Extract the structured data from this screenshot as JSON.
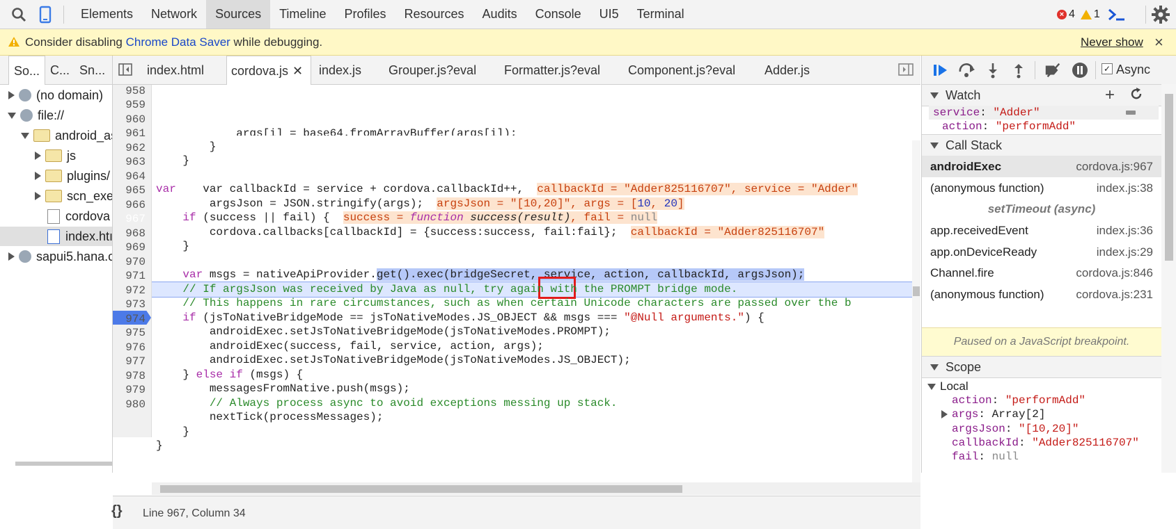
{
  "top_tabs": [
    "Elements",
    "Network",
    "Sources",
    "Timeline",
    "Profiles",
    "Resources",
    "Audits",
    "Console",
    "UI5",
    "Terminal"
  ],
  "active_top_tab": "Sources",
  "counts": {
    "errors": "4",
    "warnings": "1"
  },
  "infobar": {
    "prefix": "Consider disabling ",
    "link": "Chrome Data Saver",
    "suffix": " while debugging.",
    "dismiss": "Never show"
  },
  "nav_tabs": [
    "So...",
    "C...",
    "Sn..."
  ],
  "tree": [
    {
      "label": "(no domain)"
    },
    {
      "label": "file://"
    },
    {
      "label": "android_as"
    },
    {
      "label": "js"
    },
    {
      "label": "plugins/"
    },
    {
      "label": "scn_exer"
    },
    {
      "label": "cordova"
    },
    {
      "label": "index.htı"
    },
    {
      "label": "sapui5.hana.c"
    }
  ],
  "file_tabs": [
    "index.html",
    "cordova.js",
    "index.js",
    "Grouper.js?eval",
    "Formatter.js?eval",
    "Component.js?eval",
    "Adder.js"
  ],
  "active_file_tab": "cordova.js",
  "line_numbers": [
    "958",
    "959",
    "960",
    "961",
    "962",
    "963",
    "964",
    "965",
    "966",
    "967",
    "968",
    "969",
    "970",
    "971",
    "972",
    "973",
    "974",
    "975",
    "976",
    "977",
    "978",
    "979",
    "980"
  ],
  "code": {
    "l957": "            args[i] = base64.fromArrayBuffer(args[i]);",
    "l958": "        }",
    "l959": "    }",
    "l961a": "    var callbackId = service + cordova.callbackId++,  ",
    "l961i": "callbackId = \"Adder825116707\", service = \"Adder\"",
    "l962a": "        argsJson = JSON.stringify(args);  ",
    "l962i1": "argsJson = \"[10,20]\", args = [",
    "l962n1": "10",
    "l962i2": ", ",
    "l962n2": "20",
    "l962i3": "]",
    "l963kw": "if",
    "l963a": " (success || fail) {  ",
    "l963i1": "success = ",
    "l963i2": "function",
    "l963i3": " success(result)",
    "l963i4": ", fail = ",
    "l963i5": "null",
    "l964a": "        cordova.callbacks[callbackId] = {success:success, fail:fail};  ",
    "l964i": "callbackId = \"Adder825116707\"",
    "l965": "    }",
    "l967kw": "var",
    "l967a": " msgs = nativeApiProvider.",
    "l967s1": "get()",
    "l967s2": ".exec",
    "l967s3": "(bridgeSecret, service, action, callbackId, argsJson);",
    "l968": "    // If argsJson was received by Java as null, try again with the PROMPT bridge mode.",
    "l969": "    // This happens in rare circumstances, such as when certain Unicode characters are passed over the bridge.",
    "l970a": " (jsToNativeBridgeMode == jsToNativeModes.JS_OBJECT && msgs === ",
    "l970s": "\"@Null arguments.\"",
    "l970b": ") {",
    "l971": "        androidExec.setJsToNativeBridgeMode(jsToNativeModes.PROMPT);",
    "l972": "        androidExec(success, fail, service, action, args);",
    "l973": "        androidExec.setJsToNativeBridgeMode(jsToNativeModes.JS_OBJECT);",
    "l974a": "    } ",
    "l974kw": "else if",
    "l974b": " (msgs) {",
    "l975": "        messagesFromNative.push(msgs);",
    "l976": "        // Always process async to avoid exceptions messing up stack.",
    "l977": "        nextTick(processMessages);",
    "l978": "    }",
    "l979": "}",
    "kw_var": "var",
    "kw_if": "if"
  },
  "status": {
    "braces": "{}",
    "position": "Line 967, Column 34"
  },
  "debug": {
    "async_label": "Async",
    "watch": {
      "title": "Watch",
      "items": [
        {
          "key": "service",
          "sep": ": ",
          "value": "\"Adder\""
        },
        {
          "key": "action",
          "sep": ": ",
          "value": "\"performAdd\""
        }
      ]
    },
    "call_stack": {
      "title": "Call Stack",
      "frames": [
        {
          "fn": "androidExec",
          "loc": "cordova.js:967"
        },
        {
          "fn": "(anonymous function)",
          "loc": "index.js:38"
        },
        {
          "fn": "setTimeout (async)",
          "loc": ""
        },
        {
          "fn": "app.receivedEvent",
          "loc": "index.js:36"
        },
        {
          "fn": "app.onDeviceReady",
          "loc": "index.js:29"
        },
        {
          "fn": "Channel.fire",
          "loc": "cordova.js:846"
        },
        {
          "fn": "(anonymous function)",
          "loc": "cordova.js:231"
        }
      ]
    },
    "paused": "Paused on a JavaScript breakpoint.",
    "scope": {
      "title": "Scope",
      "local": "Local",
      "vars": [
        {
          "key": "action",
          "sep": ": ",
          "value": "\"performAdd\""
        },
        {
          "key": "args",
          "sep": ": ",
          "value": "Array[2]"
        },
        {
          "key": "argsJson",
          "sep": ": ",
          "value": "\"[10,20]\""
        },
        {
          "key": "callbackId",
          "sep": ": ",
          "value": "\"Adder825116707\""
        },
        {
          "key": "fail",
          "sep": ": ",
          "value": "null"
        }
      ]
    }
  },
  "colors": {
    "accent": "#4c7ae8",
    "error": "#e0312b",
    "warning": "#f2b100",
    "highlight_box": "#e21b1b"
  }
}
